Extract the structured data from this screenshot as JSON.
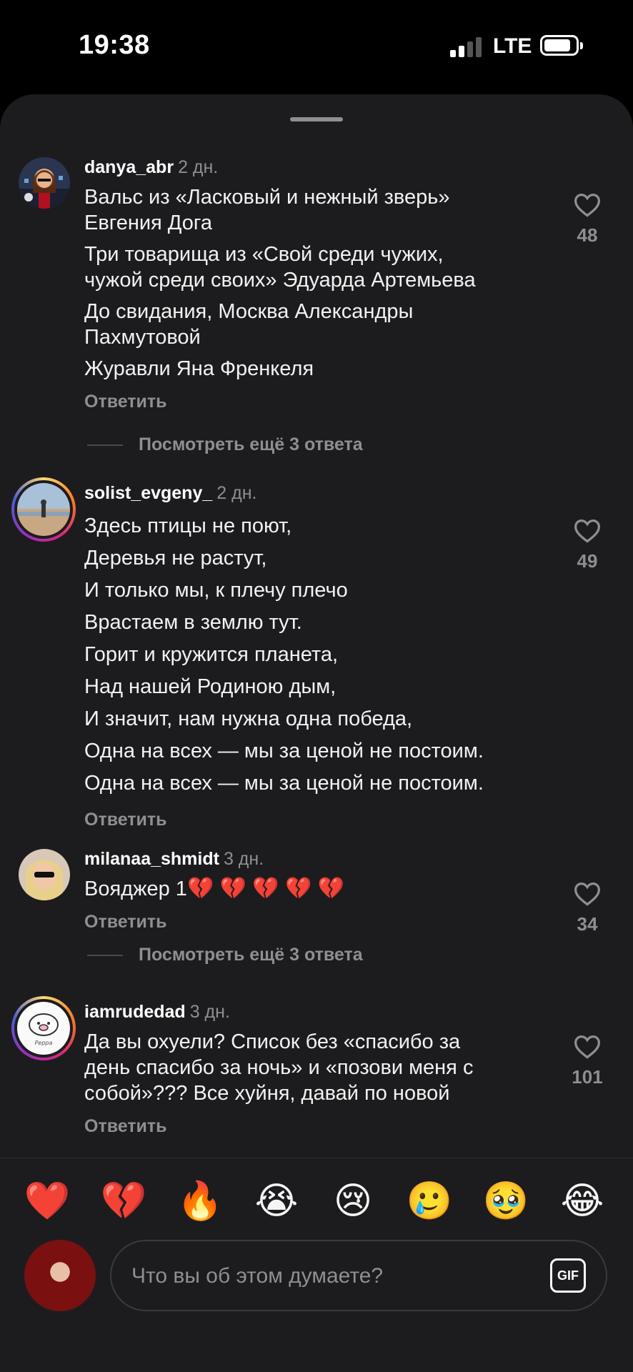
{
  "status_bar": {
    "time": "19:38",
    "network": "LTE"
  },
  "comments": [
    {
      "username": "danya_abr",
      "time": "2 дн.",
      "paragraphs": [
        [
          "Вальс из «Ласковый и нежный зверь»",
          "Евгения Дога"
        ],
        [
          "Три товарища из «Свой среди чужих,",
          "чужой среди своих» Эдуарда Артемьева"
        ],
        [
          "До свидания, Москва Александры",
          "Пахмутовой"
        ],
        [
          "Журавли Яна Френкеля"
        ]
      ],
      "reply_label": "Ответить",
      "likes": "48",
      "more_replies": "Посмотреть ещё 3 ответа"
    },
    {
      "username": "solist_evgeny_",
      "time": "2 дн.",
      "lines": [
        "Здесь птицы не поют,",
        "Деревья не растут,",
        "И только мы, к плечу плечо",
        "Врастаем в землю тут.",
        "Горит и кружится планета,",
        "Над нашей Родиною дым,",
        "И значит, нам нужна одна победа,",
        "Одна на всех — мы за ценой не постоим.",
        "Одна на всех — мы за ценой не постоим."
      ],
      "reply_label": "Ответить",
      "likes": "49"
    },
    {
      "username": "milanaa_shmidt",
      "time": "3 дн.",
      "text": "Вояджер 1",
      "emojis": "💔 💔 💔 💔 💔",
      "reply_label": "Ответить",
      "likes": "34",
      "more_replies": "Посмотреть ещё 3 ответа"
    },
    {
      "username": "iamrudedad",
      "time": "3 дн.",
      "lines": [
        "Да вы охуели? Список без «спасибо за",
        "день спасибо за ночь» и «позови меня с",
        "собой»??? Все хуйня, давай по новой"
      ],
      "reply_label": "Ответить",
      "likes": "101"
    }
  ],
  "emoji_bar": [
    "❤️",
    "💔",
    "🔥",
    "😭",
    "😢",
    "🥲",
    "🥹",
    "😂"
  ],
  "input": {
    "placeholder": "Что вы об этом думаете?",
    "gif_label": "GIF"
  }
}
